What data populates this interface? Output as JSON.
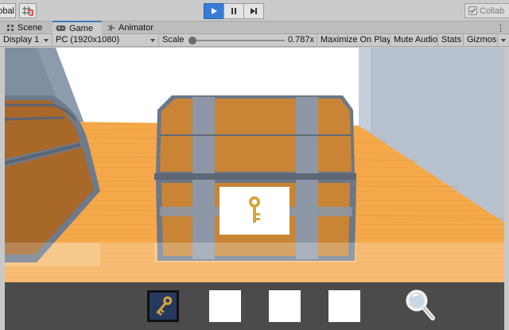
{
  "toolbar": {
    "global_label": "Global",
    "collab_label": "Collab",
    "play_buttons": [
      "play",
      "pause",
      "step"
    ]
  },
  "tabs": [
    {
      "label": "Scene",
      "icon": "scene-grid-icon"
    },
    {
      "label": "Game",
      "icon": "gamepad-icon",
      "active": true
    },
    {
      "label": "Animator",
      "icon": "animator-icon"
    }
  ],
  "game_toolbar": {
    "display": "Display 1",
    "resolution": "PC (1920x1080)",
    "scale_label": "Scale",
    "scale_value": "0.787x",
    "scale_fraction": 0.0,
    "maximize": "Maximize On Play",
    "mute": "Mute Audio",
    "stats": "Stats",
    "gizmos": "Gizmos"
  },
  "scene": {
    "chest_label_icon": "key-icon",
    "colors": {
      "floor": "#f5a94a",
      "wall_left": "#8f9fb0",
      "wall_right": "#b8c3cf",
      "back_wall": "#ffffff",
      "wood": "#c98535",
      "band": "#8d97a6",
      "key": "#d4a63a"
    }
  },
  "inventory": {
    "slots": [
      {
        "item": "key-icon",
        "selected": true
      },
      {
        "item": "",
        "selected": false
      },
      {
        "item": "",
        "selected": false
      },
      {
        "item": "",
        "selected": false
      }
    ],
    "tool_icon": "magnifier-icon",
    "background": "#4b4b4b"
  }
}
